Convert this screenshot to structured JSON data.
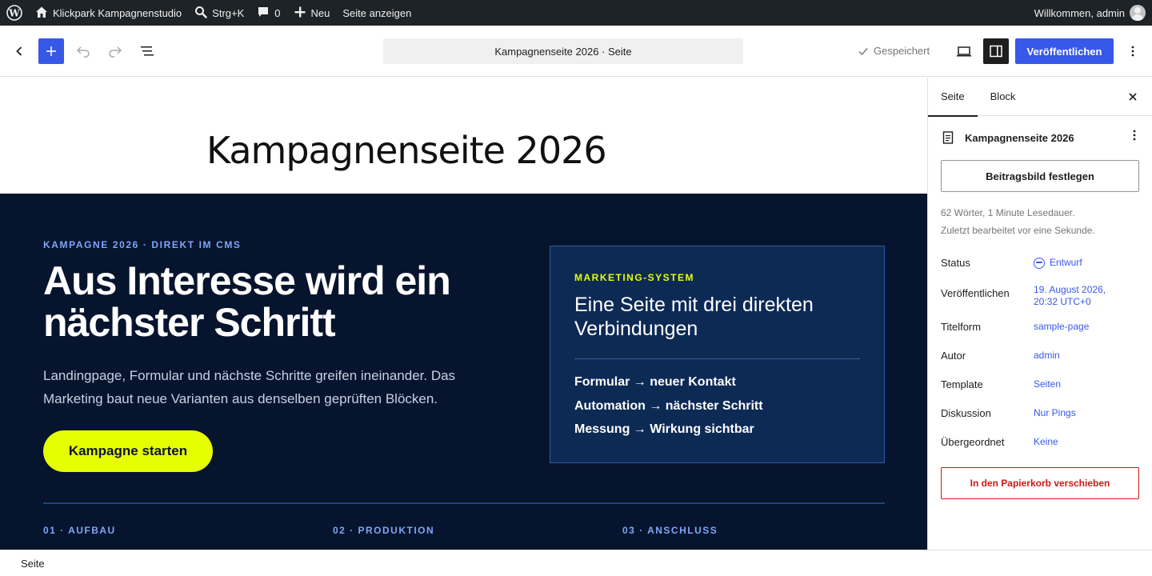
{
  "admin_bar": {
    "site_name": "Klickpark Kampagnenstudio",
    "search_shortcut": "Strg+K",
    "comments_count": "0",
    "new_label": "Neu",
    "view_page": "Seite anzeigen",
    "greeting": "Willkommen, admin"
  },
  "header": {
    "document_title": "Kampagnenseite 2026 · Seite",
    "saved_label": "Gespeichert",
    "publish_label": "Veröffentlichen"
  },
  "canvas": {
    "post_title": "Kampagnenseite 2026",
    "eyebrow": "KAMPAGNE 2026 · DIREKT IM CMS",
    "heading": "Aus Interesse wird ein nächster Schritt",
    "paragraph": "Landingpage, Formular und nächste Schritte greifen ineinander. Das Marketing baut neue Varianten aus denselben geprüften Blöcken.",
    "cta_label": "Kampagne starten",
    "card": {
      "eyebrow": "MARKETING-SYSTEM",
      "heading": "Eine Seite mit drei direkten Verbindungen",
      "items": [
        "Formular → neuer Kontakt",
        "Automation → nächster Schritt",
        "Messung → Wirkung sichtbar"
      ]
    },
    "steps": [
      "01 · AUFBAU",
      "02 · PRODUKTION",
      "03 · ANSCHLUSS"
    ]
  },
  "sidebar": {
    "tabs": [
      "Seite",
      "Block"
    ],
    "doc_title": "Kampagnenseite 2026",
    "featured_image_button": "Beitragsbild festlegen",
    "meta_words": "62 Wörter, 1 Minute Lesedauer.",
    "meta_edited": "Zuletzt bearbeitet vor eine Sekunde.",
    "rows": [
      {
        "label": "Status",
        "value": "Entwurf"
      },
      {
        "label": "Veröffentlichen",
        "value": "19. August 2026,",
        "value2": "20:32 UTC+0"
      },
      {
        "label": "Titelform",
        "value": "sample-page"
      },
      {
        "label": "Autor",
        "value": "admin"
      },
      {
        "label": "Template",
        "value": "Seiten"
      },
      {
        "label": "Diskussion",
        "value": "Nur Pings"
      },
      {
        "label": "Übergeordnet",
        "value": "Keine"
      }
    ],
    "trash_button": "In den Papierkorb verschieben"
  },
  "footer": {
    "breadcrumb": "Seite"
  },
  "colors": {
    "accent": "#3858e9",
    "hero_bg": "#07142e",
    "cta": "#e6ff00",
    "danger": "#cc1818"
  }
}
